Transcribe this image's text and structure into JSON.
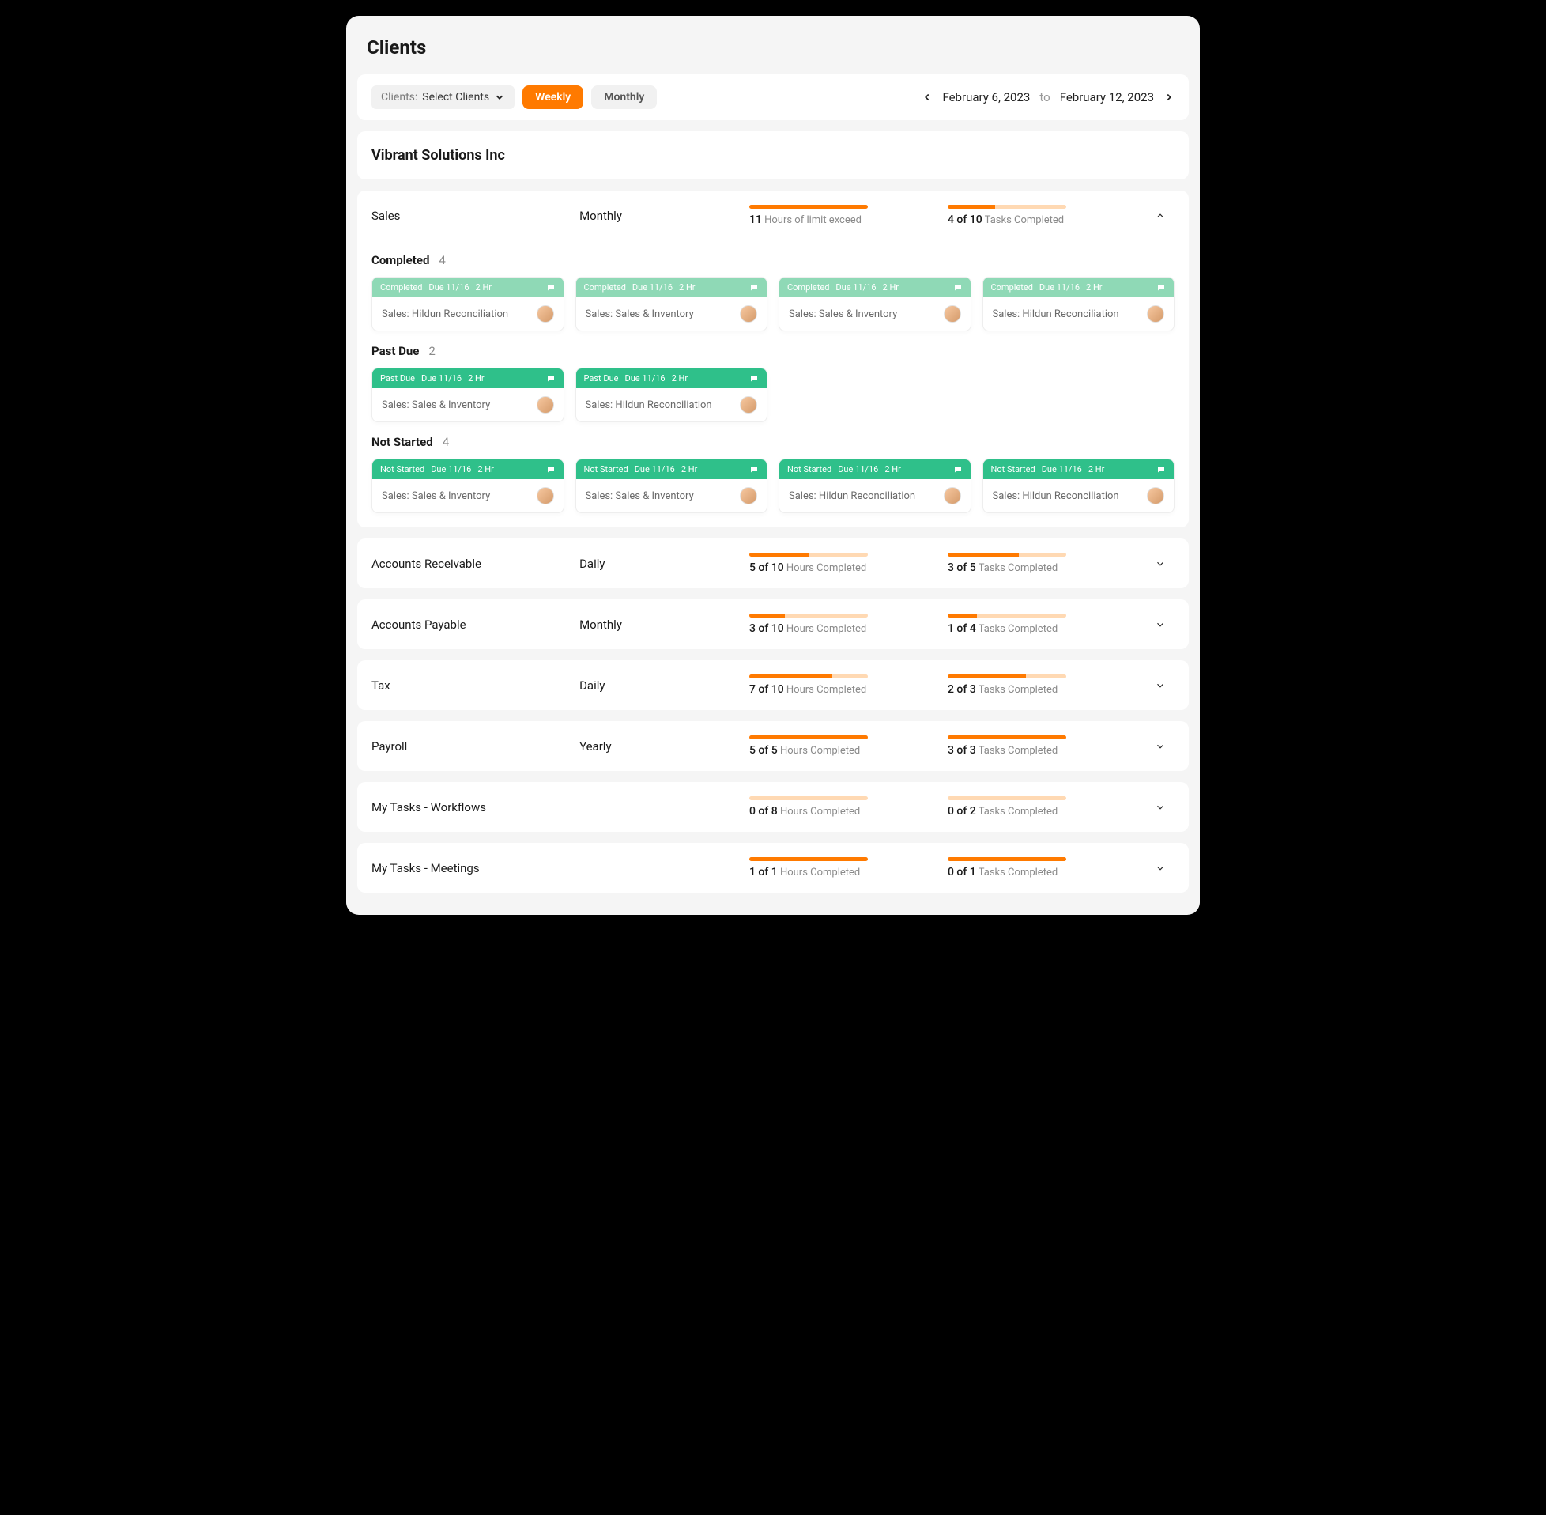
{
  "page_title": "Clients",
  "filters": {
    "client_label": "Clients:",
    "client_value": "Select Clients",
    "tabs": {
      "weekly": "Weekly",
      "monthly": "Monthly"
    }
  },
  "date_range": {
    "start": "February 6, 2023",
    "connector": "to",
    "end": "February 12, 2023"
  },
  "client_name": "Vibrant Solutions Inc",
  "sections": {
    "sales": {
      "name": "Sales",
      "frequency": "Monthly",
      "hours_value": "11",
      "hours_label": "Hours of limit exceed",
      "hours_pct": 100,
      "tasks_value": "4 of 10",
      "tasks_label": "Tasks Completed",
      "tasks_pct": 40
    },
    "ar": {
      "name": "Accounts Receivable",
      "frequency": "Daily",
      "hours_value": "5 of 10",
      "hours_label": "Hours Completed",
      "hours_pct": 50,
      "tasks_value": "3 of 5",
      "tasks_label": "Tasks Completed",
      "tasks_pct": 60
    },
    "ap": {
      "name": "Accounts Payable",
      "frequency": "Monthly",
      "hours_value": "3 of 10",
      "hours_label": "Hours Completed",
      "hours_pct": 30,
      "tasks_value": "1 of 4",
      "tasks_label": "Tasks Completed",
      "tasks_pct": 25
    },
    "tax": {
      "name": "Tax",
      "frequency": "Daily",
      "hours_value": "7 of 10",
      "hours_label": "Hours Completed",
      "hours_pct": 70,
      "tasks_value": "2 of 3",
      "tasks_label": "Tasks Completed",
      "tasks_pct": 66
    },
    "payroll": {
      "name": "Payroll",
      "frequency": "Yearly",
      "hours_value": "5 of 5",
      "hours_label": "Hours Completed",
      "hours_pct": 100,
      "tasks_value": "3 of 3",
      "tasks_label": "Tasks Completed",
      "tasks_pct": 100
    },
    "workflows": {
      "name": "My Tasks - Workflows",
      "frequency": "",
      "hours_value": "0 of 8",
      "hours_label": "Hours Completed",
      "hours_pct": 0,
      "tasks_value": "0 of 2",
      "tasks_label": "Tasks Completed",
      "tasks_pct": 0
    },
    "meetings": {
      "name": "My Tasks - Meetings",
      "frequency": "",
      "hours_value": "1 of 1",
      "hours_label": "Hours Completed",
      "hours_pct": 100,
      "tasks_value": "0 of 1",
      "tasks_label": "Tasks Completed",
      "tasks_pct": 100
    }
  },
  "groups": {
    "completed": {
      "title": "Completed",
      "count": "4"
    },
    "past_due": {
      "title": "Past Due",
      "count": "2"
    },
    "not_started": {
      "title": "Not Started",
      "count": "4"
    }
  },
  "card_meta": {
    "status_completed": "Completed",
    "status_pastdue": "Past Due",
    "status_notstarted": "Not Started",
    "due": "Due 11/16",
    "hours": "2 Hr"
  },
  "card_titles": {
    "hildun": "Sales: Hildun Reconciliation",
    "inventory": "Sales: Sales & Inventory"
  }
}
